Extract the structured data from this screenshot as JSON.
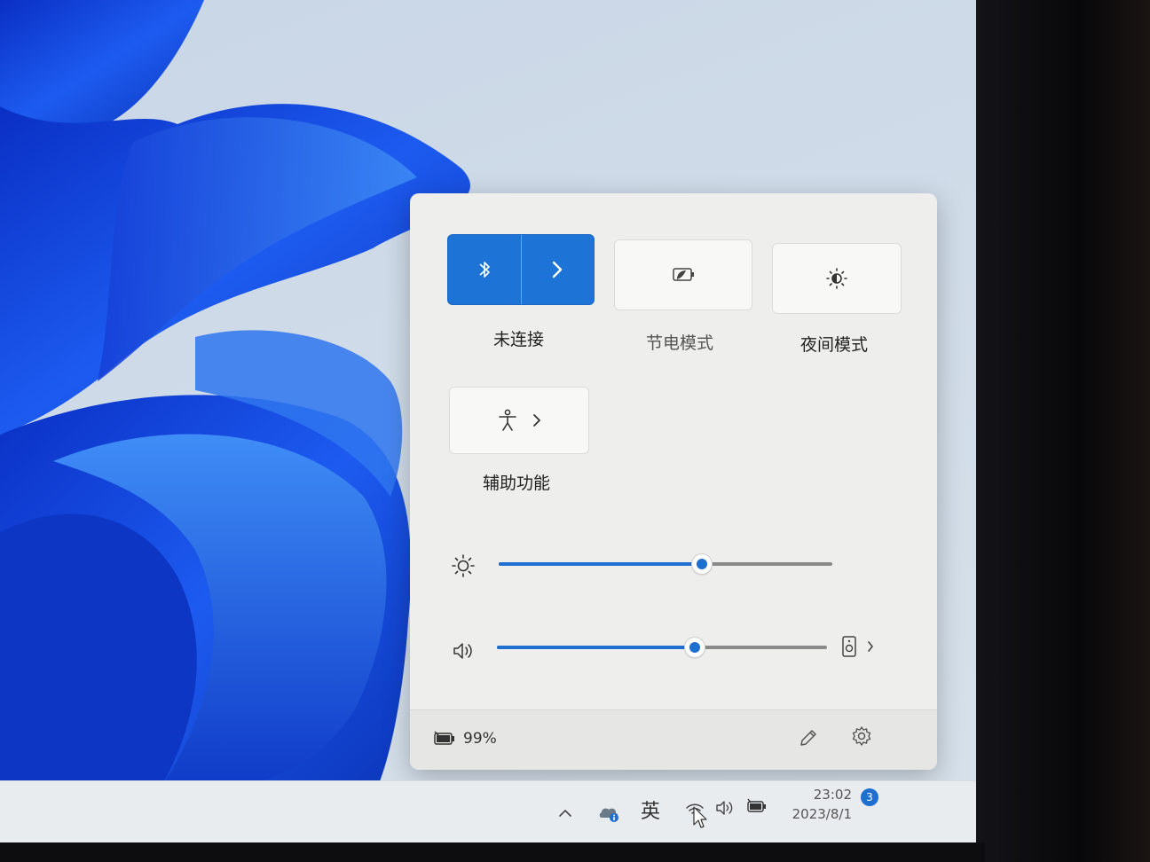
{
  "quick_settings": {
    "bluetooth": {
      "label": "未连接",
      "state": "on",
      "icon": "bluetooth-icon",
      "expand_icon": "chevron-right-icon"
    },
    "battery_saver": {
      "label": "节电模式",
      "state": "off",
      "icon": "battery-saver-icon"
    },
    "night_light": {
      "label": "夜间模式",
      "state": "off",
      "icon": "night-light-icon"
    },
    "accessibility": {
      "label": "辅助功能",
      "icon": "accessibility-icon",
      "expand_icon": "chevron-right-icon"
    },
    "brightness": {
      "icon": "brightness-icon",
      "level_fraction": 0.61
    },
    "volume": {
      "icon": "speaker-icon",
      "level_fraction": 0.6,
      "device_icon": "speaker-device-icon",
      "expand_icon": "chevron-right-icon"
    },
    "footer": {
      "battery_percent": "99%",
      "battery_icon": "battery-charging-icon",
      "edit_icon": "pencil-icon",
      "settings_icon": "gear-icon"
    }
  },
  "taskbar": {
    "tray_overflow_icon": "chevron-up-icon",
    "onedrive_icon": "onedrive-icon",
    "ime_label": "英",
    "network_icon": "wifi-icon",
    "volume_icon": "speaker-icon",
    "battery_icon": "battery-charging-icon",
    "time": "23:02",
    "date": "2023/8/1",
    "notification_count": "3"
  },
  "colors": {
    "accent": "#1e74d6",
    "panel_bg": "#eeeeed",
    "wallpaper_blue": "#1a4fe0"
  }
}
